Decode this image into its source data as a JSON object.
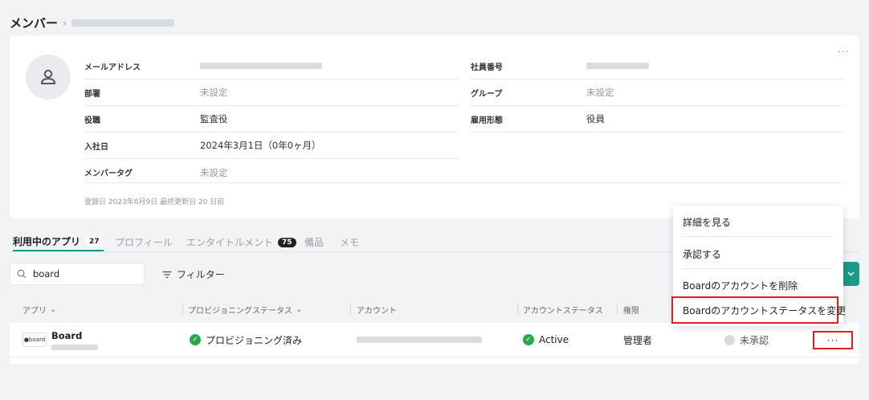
{
  "breadcrumb": {
    "root": "メンバー",
    "separator": "›"
  },
  "profile": {
    "fields_left": [
      {
        "label": "メールアドレス",
        "value": "",
        "muted": false
      },
      {
        "label": "部署",
        "value": "未設定",
        "muted": true
      },
      {
        "label": "役職",
        "value": "監査役",
        "muted": false
      },
      {
        "label": "入社日",
        "value": "2024年3月1日（0年0ヶ月）",
        "muted": false
      },
      {
        "label": "メンバータグ",
        "value": "未設定",
        "muted": true
      }
    ],
    "fields_right": [
      {
        "label": "社員番号",
        "value": "",
        "muted": false
      },
      {
        "label": "グループ",
        "value": "未設定",
        "muted": true
      },
      {
        "label": "雇用形態",
        "value": "役員",
        "muted": false
      }
    ],
    "meta": "登録日 2023年8月9日  最終更新日 20 日前",
    "more": "···"
  },
  "tabs": [
    {
      "label": "利用中のアプリ",
      "count": "27",
      "active": true
    },
    {
      "label": "プロフィール",
      "count": "",
      "active": false
    },
    {
      "label": "エンタイトルメント",
      "count": "75",
      "active": false
    },
    {
      "label": "備品",
      "count": "",
      "active": false
    },
    {
      "label": "メモ",
      "count": "",
      "active": false
    }
  ],
  "toolbar": {
    "search_value": "board",
    "filter_label": "フィルター"
  },
  "table": {
    "headers": {
      "app": "アプリ",
      "provisioning": "プロビジョニングステータス",
      "account": "アカウント",
      "account_status": "アカウントステータス",
      "role": "権限"
    },
    "row": {
      "logo_text": "●board",
      "app_name": "Board",
      "provisioning": "プロビジョニング済み",
      "account_status": "Active",
      "role": "管理者",
      "approval": "未承認",
      "more": "···"
    }
  },
  "context_menu": {
    "items": [
      "詳細を見る",
      "承認する",
      "Boardのアカウントを削除",
      "Boardのアカウントステータスを変更"
    ]
  },
  "colors": {
    "accent": "#1a9b87",
    "highlight": "#e02020",
    "success": "#2aa84a"
  }
}
